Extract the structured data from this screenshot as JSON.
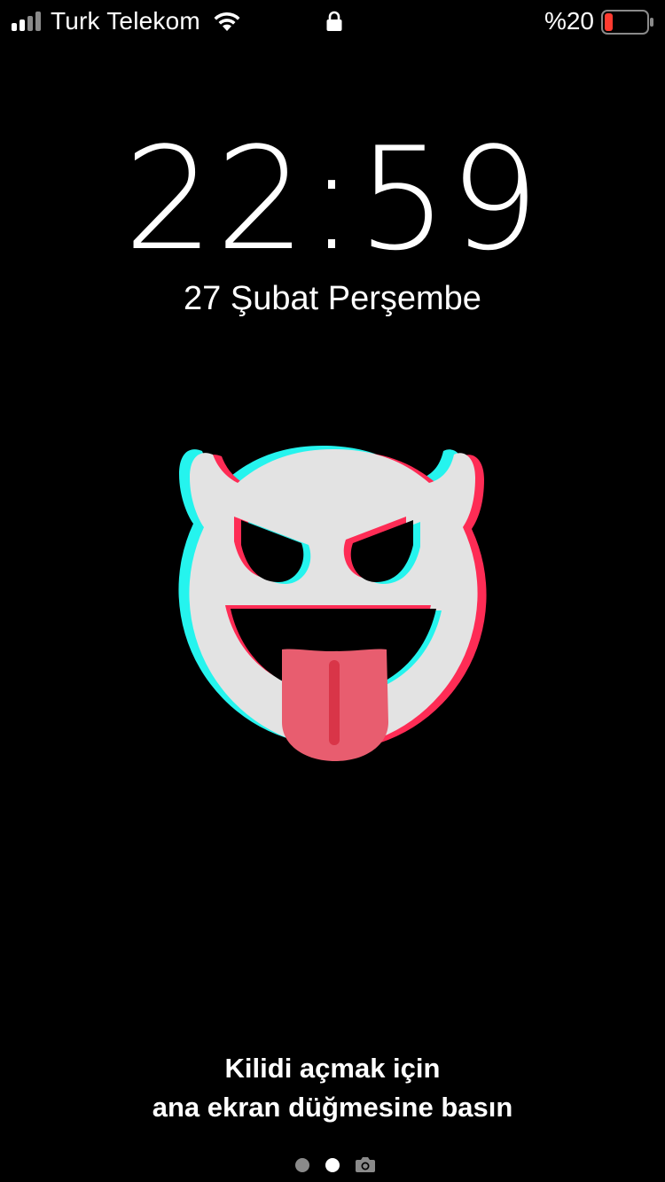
{
  "status_bar": {
    "carrier": "Turk Telekom",
    "signal_icon": "cellular-signal-icon",
    "wifi_icon": "wifi-icon",
    "lock_icon": "lock-icon",
    "battery_text": "%20",
    "battery_icon": "battery-low-icon",
    "battery_level": 0.2,
    "battery_color": "#ff3b30"
  },
  "lock_screen": {
    "time": "22:59",
    "date": "27 Şubat Perşembe",
    "hint_line1": "Kilidi açmak için",
    "hint_line2": "ana ekran düğmesine basın"
  },
  "wallpaper": {
    "subject": "devil-emoji-icon",
    "colors": {
      "face": "#e3e3e3",
      "cyan": "#25f4ee",
      "red": "#fe2c55",
      "tongue": "#e85d6f"
    }
  },
  "page_indicator": {
    "dots": 2,
    "active_index": 1,
    "camera_icon": "camera-icon"
  }
}
